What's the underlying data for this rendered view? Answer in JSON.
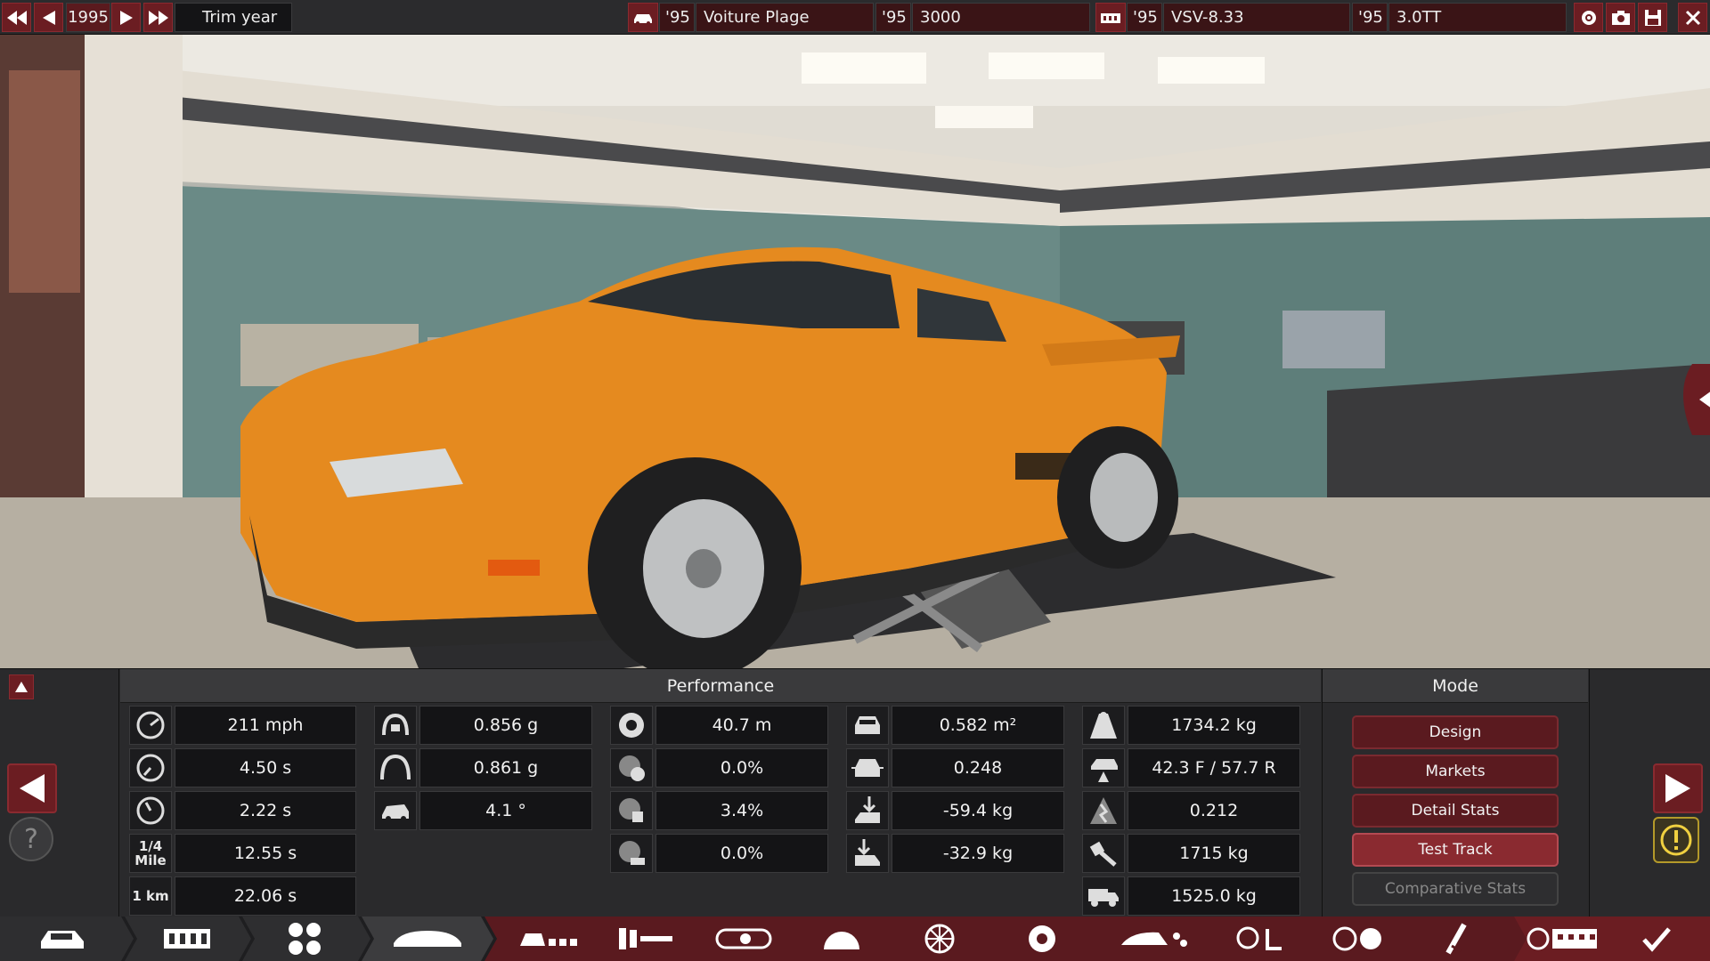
{
  "topbar": {
    "year": "1995",
    "trim_year_label": "Trim year",
    "model_year": "'95",
    "model_name": "Voiture Plage",
    "trim_year": "'95",
    "trim_name": "3000",
    "engine_year": "'95",
    "engine_name": "VSV-8.33",
    "variant_year": "'95",
    "variant_name": "3.0TT"
  },
  "performance": {
    "title": "Performance",
    "col1": [
      {
        "icon": "top-speed-icon",
        "value": "211 mph"
      },
      {
        "icon": "acceleration-0-100-icon",
        "value": "4.50 s"
      },
      {
        "icon": "acceleration-0-60-icon",
        "value": "2.22 s"
      },
      {
        "icon": "quarter-mile-icon",
        "label": "1/4 Mile",
        "value": "12.55 s"
      },
      {
        "icon": "one-km-icon",
        "label": "1 km",
        "value": "22.06 s"
      }
    ],
    "col2": [
      {
        "icon": "lateral-g-low-icon",
        "value": "0.856 g"
      },
      {
        "icon": "lateral-g-high-icon",
        "value": "0.861 g"
      },
      {
        "icon": "body-roll-icon",
        "value": "4.1 °"
      }
    ],
    "col3": [
      {
        "icon": "braking-distance-icon",
        "value": "40.7 m"
      },
      {
        "icon": "brake-fade-icon",
        "value": "0.0%"
      },
      {
        "icon": "brake-fade-race-icon",
        "value": "3.4%"
      },
      {
        "icon": "brake-fade-tow-icon",
        "value": "0.0%"
      }
    ],
    "col4": [
      {
        "icon": "frontal-area-icon",
        "value": "0.582 m²"
      },
      {
        "icon": "drag-coefficient-icon",
        "value": "0.248"
      },
      {
        "icon": "front-downforce-icon",
        "value": "-59.4 kg"
      },
      {
        "icon": "rear-downforce-icon",
        "value": "-32.9 kg"
      }
    ],
    "col5": [
      {
        "icon": "weight-icon",
        "value": "1734.2 kg"
      },
      {
        "icon": "weight-distribution-icon",
        "value": "42.3 F / 57.7 R"
      },
      {
        "icon": "weight-ratio-icon",
        "value": "0.212"
      },
      {
        "icon": "tow-capacity-icon",
        "value": "1715 kg"
      },
      {
        "icon": "payload-icon",
        "value": "1525.0 kg"
      }
    ]
  },
  "mode": {
    "title": "Mode",
    "buttons": [
      "Design",
      "Markets",
      "Detail Stats",
      "Test Track",
      "Comparative Stats"
    ]
  },
  "nav": {
    "tabs": [
      "car-model-icon",
      "chassis-icon",
      "suspension-icon",
      "body-icon",
      "trim-icon",
      "fixtures-icon",
      "engine-icon",
      "transmission-icon",
      "wheels-icon",
      "brakes-icon",
      "aero-icon",
      "interior-icon",
      "steering-icon",
      "test-drive-icon",
      "dyno-icon",
      "finish-icon"
    ]
  },
  "colors": {
    "accent": "#6b1d22",
    "car": "#e58a1f",
    "panel": "#2a2a2c"
  }
}
